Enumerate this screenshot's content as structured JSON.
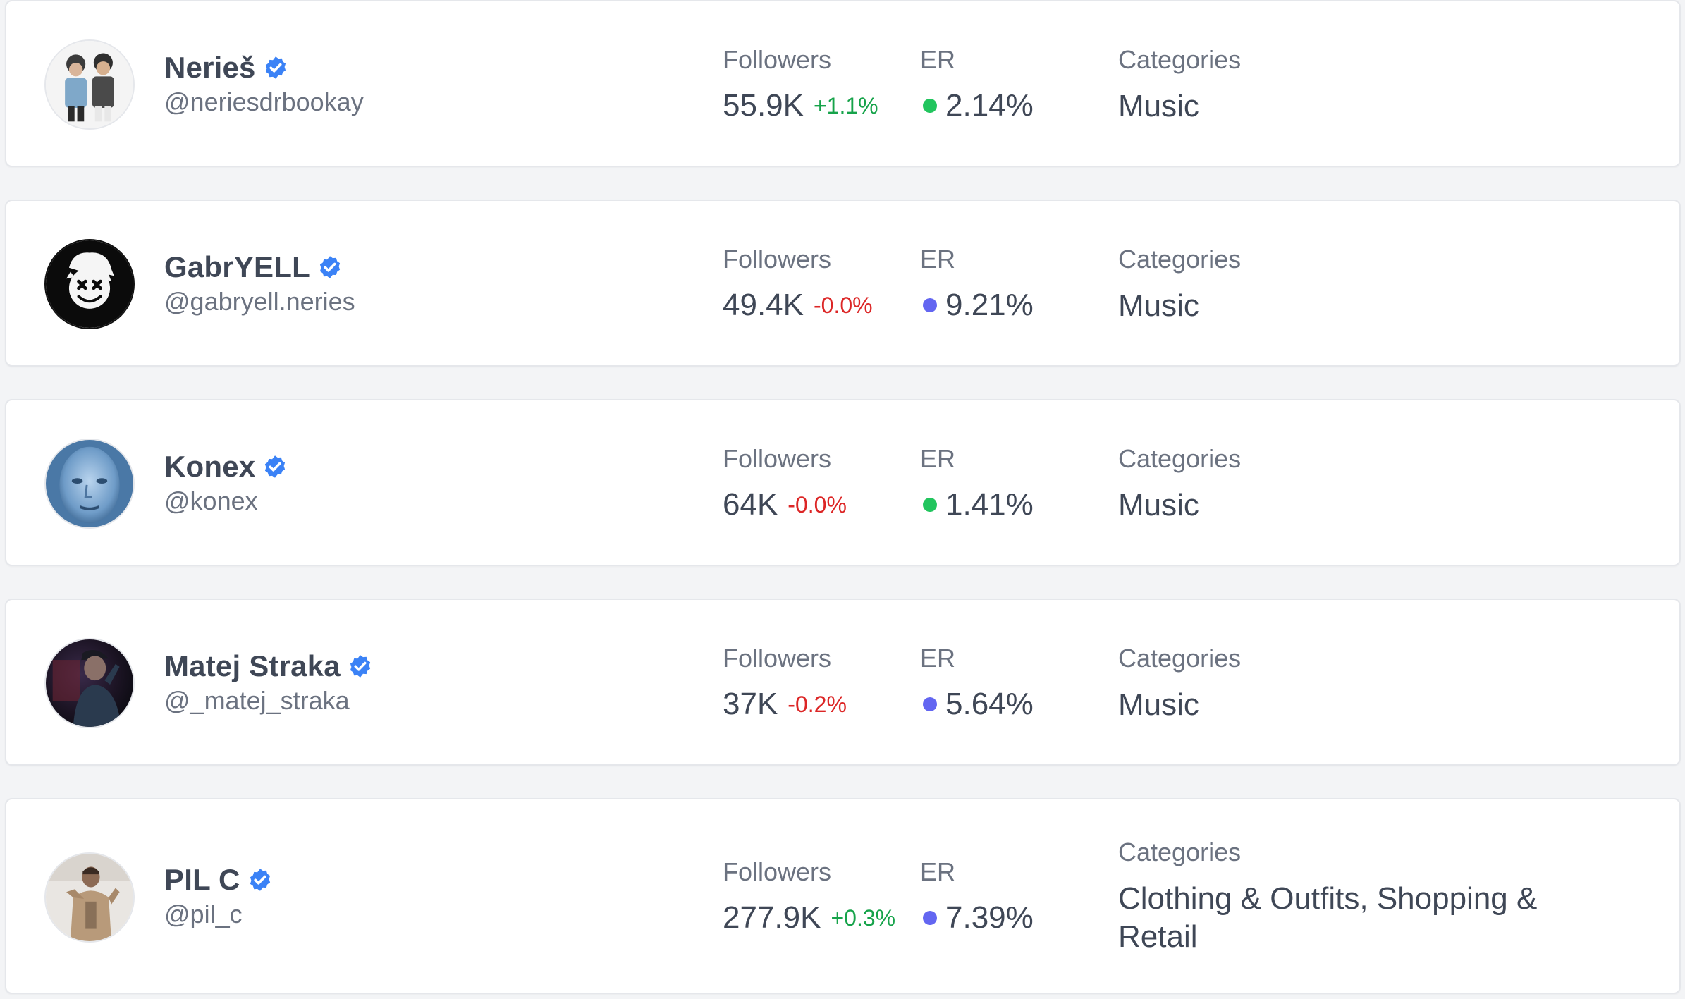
{
  "labels": {
    "followers": "Followers",
    "er": "ER",
    "categories": "Categories"
  },
  "colors": {
    "positive": "#16a34a",
    "negative": "#dc2626",
    "er_good": "#22c55e",
    "er_high": "#6366f1",
    "verified": "#3b82f6"
  },
  "influencers": [
    {
      "name": "Nerieš",
      "handle": "@neriesdrbookay",
      "verified": true,
      "avatar_icon": "avatar-two-men-photo",
      "followers": "55.9K",
      "followers_change": "+1.1%",
      "change_direction": "up",
      "er": "2.14%",
      "er_dot_color": "#22c55e",
      "categories": "Music"
    },
    {
      "name": "GabrYELL",
      "handle": "@gabryell.neries",
      "verified": true,
      "avatar_icon": "avatar-xx-face-logo",
      "followers": "49.4K",
      "followers_change": "-0.0%",
      "change_direction": "down",
      "er": "9.21%",
      "er_dot_color": "#6366f1",
      "categories": "Music"
    },
    {
      "name": "Konex",
      "handle": "@konex",
      "verified": true,
      "avatar_icon": "avatar-blue-face-photo",
      "followers": "64K",
      "followers_change": "-0.0%",
      "change_direction": "down",
      "er": "1.41%",
      "er_dot_color": "#22c55e",
      "categories": "Music"
    },
    {
      "name": "Matej Straka",
      "handle": "@_matej_straka",
      "verified": true,
      "avatar_icon": "avatar-man-cap-dark-photo",
      "followers": "37K",
      "followers_change": "-0.2%",
      "change_direction": "down",
      "er": "5.64%",
      "er_dot_color": "#6366f1",
      "categories": "Music"
    },
    {
      "name": "PIL C",
      "handle": "@pil_c",
      "verified": true,
      "avatar_icon": "avatar-man-jacket-photo",
      "followers": "277.9K",
      "followers_change": "+0.3%",
      "change_direction": "up",
      "er": "7.39%",
      "er_dot_color": "#6366f1",
      "categories": "Clothing & Outfits, Shopping & Retail"
    }
  ]
}
